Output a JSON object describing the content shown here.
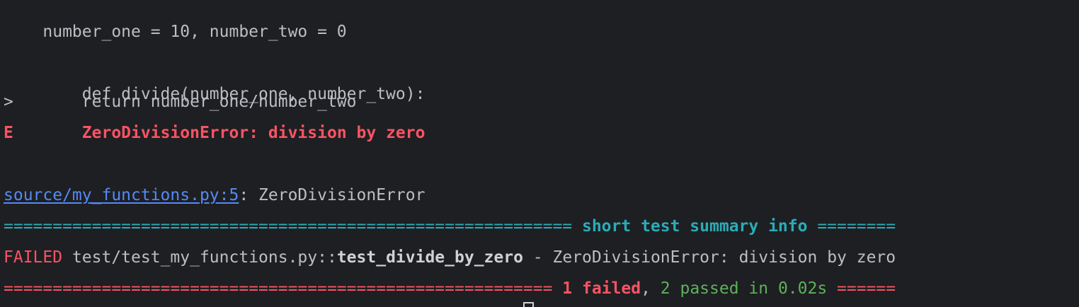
{
  "terminal": {
    "lines": {
      "vars": "number_one = 10, number_two = 0",
      "def_line": "    def divide(number_one, number_two):",
      "return_marker": ">",
      "return_code": "       return number_one/number_two",
      "error_marker": "E",
      "error_message": "       ZeroDivisionError: division by zero",
      "source_link": "source/my_functions.py:5",
      "source_suffix": ": ZeroDivisionError",
      "summary_rule_left": "========================================================== ",
      "summary_title": "short test summary info",
      "summary_rule_right": " ========",
      "failed_label": "FAILED",
      "failed_path": " test/test_my_functions.py::",
      "failed_test": "test_divide_by_zero",
      "failed_reason": " - ZeroDivisionError: division by zero",
      "result_rule_left": "======================================================== ",
      "result_failed": "1 failed",
      "result_comma": ", ",
      "result_passed": "2 passed in 0.02s",
      "result_rule_right": " ======"
    },
    "colors": {
      "background": "#1e1f22",
      "text": "#bcbec4",
      "error": "#f75464",
      "info": "#2aacb8",
      "passed": "#5fb05c",
      "link": "#548af7"
    }
  }
}
